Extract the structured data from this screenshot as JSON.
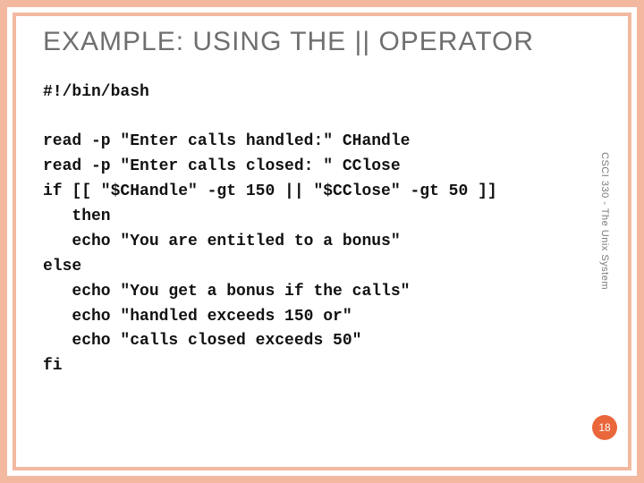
{
  "title": "EXAMPLE: USING THE || OPERATOR",
  "code": "#!/bin/bash\n\nread -p \"Enter calls handled:\" CHandle\nread -p \"Enter calls closed: \" CClose\nif [[ \"$CHandle\" -gt 150 || \"$CClose\" -gt 50 ]]\n   then\n   echo \"You are entitled to a bonus\"\nelse\n   echo \"You get a bonus if the calls\"\n   echo \"handled exceeds 150 or\"\n   echo \"calls closed exceeds 50\"\nfi",
  "side_label": "CSCI 330 - The Unix System",
  "page_number": "18"
}
